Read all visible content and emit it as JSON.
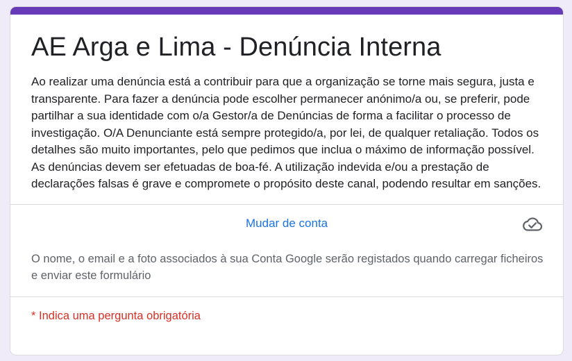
{
  "form": {
    "title": "AE Arga e Lima - Denúncia Interna",
    "description": "Ao realizar uma denúncia está a contribuir para que a organização se torne mais segura, justa e transparente. Para fazer a denúncia pode escolher permanecer anónimo/a ou, se preferir, pode partilhar a sua identidade com o/a Gestor/a de Denúncias de forma a facilitar o processo de investigação. O/A Denunciante está sempre protegido/a, por lei, de qualquer retaliação. Todos os detalhes são muito importantes, pelo que pedimos que inclua o máximo de informação possível. As denúncias devem ser efetuadas de boa-fé. A utilização indevida e/ou a prestação de declarações falsas é grave e compromete o propósito deste canal, podendo resultar em sanções."
  },
  "account": {
    "switch_label": "Mudar de conta",
    "status_icon": "cloud-done-icon",
    "privacy_notice": "O nome, o email e a foto associados à sua Conta Google serão registados quando carregar ficheiros e enviar este formulário"
  },
  "required_note": "* Indica uma pergunta obrigatória",
  "colors": {
    "accent": "#673ab7",
    "link": "#1a73e8",
    "required": "#d93025",
    "background": "#f0ebf8"
  }
}
